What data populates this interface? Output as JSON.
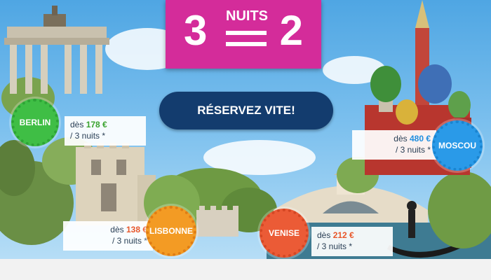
{
  "hero": {
    "left_number": "3",
    "small_text": "NUITS",
    "right_number": "2"
  },
  "cta": {
    "label": "RÉSERVEZ VITE!"
  },
  "offers": {
    "berlin": {
      "city": "BERLIN",
      "price_prefix": "dès",
      "price": "178 €",
      "nights": "/ 3 nuits *"
    },
    "lisbonne": {
      "city": "LISBONNE",
      "price_prefix": "dès",
      "price": "138 €",
      "nights": "/ 3 nuits *"
    },
    "venise": {
      "city": "VENISE",
      "price_prefix": "dès",
      "price": "212 €",
      "nights": "/ 3 nuits *"
    },
    "moscou": {
      "city": "MOSCOU",
      "price_prefix": "dès",
      "price": "480 €",
      "nights": "/ 3 nuits *"
    }
  },
  "colors": {
    "hero_pink": "#d42c9a",
    "cta_navy": "#133c6e",
    "berlin_green": "#3fbe45",
    "lisbonne_orange": "#f39b24",
    "venise_red": "#eb5b36",
    "moscou_blue": "#2a9ae8",
    "sky": "#7cc0ee"
  }
}
